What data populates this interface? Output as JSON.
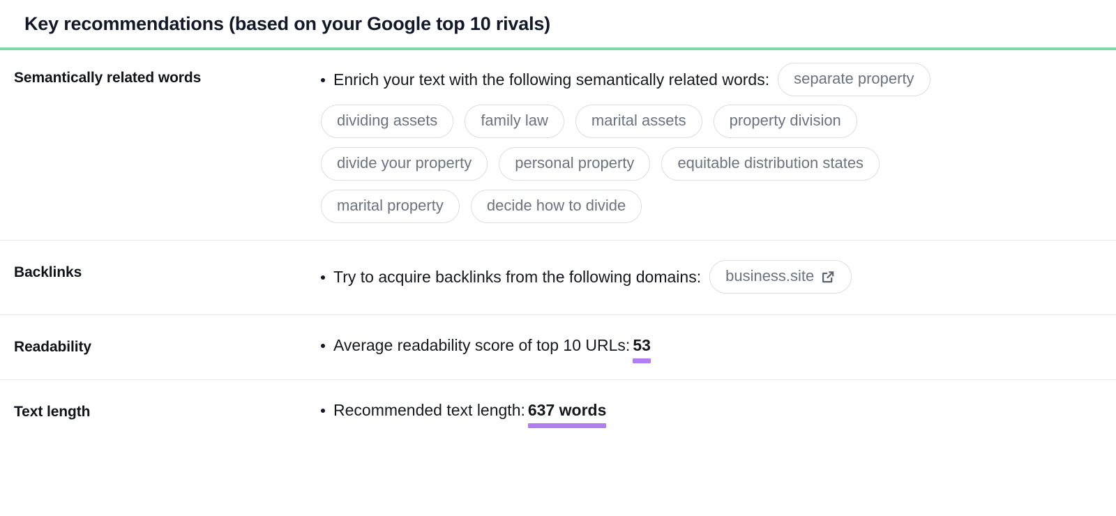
{
  "header": {
    "title": "Key recommendations (based on your Google top 10 rivals)",
    "accent_color": "#7ed9a4"
  },
  "theme": {
    "pill_border": "#dcdee5",
    "pill_text": "#6b7280",
    "highlight_underline": "#b07ef0",
    "divider": "#e8e9ed"
  },
  "rows": {
    "semantics": {
      "label": "Semantically related words",
      "bullet_text": "Enrich your text with the following semantically related words:",
      "pills_line1": [
        "separate property"
      ],
      "pills_line2": [
        "dividing assets",
        "family law",
        "marital assets",
        "property division"
      ],
      "pills_line3": [
        "divide your property",
        "personal property",
        "equitable distribution states"
      ],
      "pills_line4": [
        "marital property",
        "decide how to divide"
      ]
    },
    "backlinks": {
      "label": "Backlinks",
      "bullet_text": "Try to acquire backlinks from the following domains:",
      "domain_pill": "business.site",
      "domain_icon": "external-link-icon"
    },
    "readability": {
      "label": "Readability",
      "bullet_text": "Average readability score of top 10 URLs:",
      "value": "53"
    },
    "textlength": {
      "label": "Text length",
      "bullet_text": "Recommended text length:",
      "value": "637 words"
    }
  }
}
